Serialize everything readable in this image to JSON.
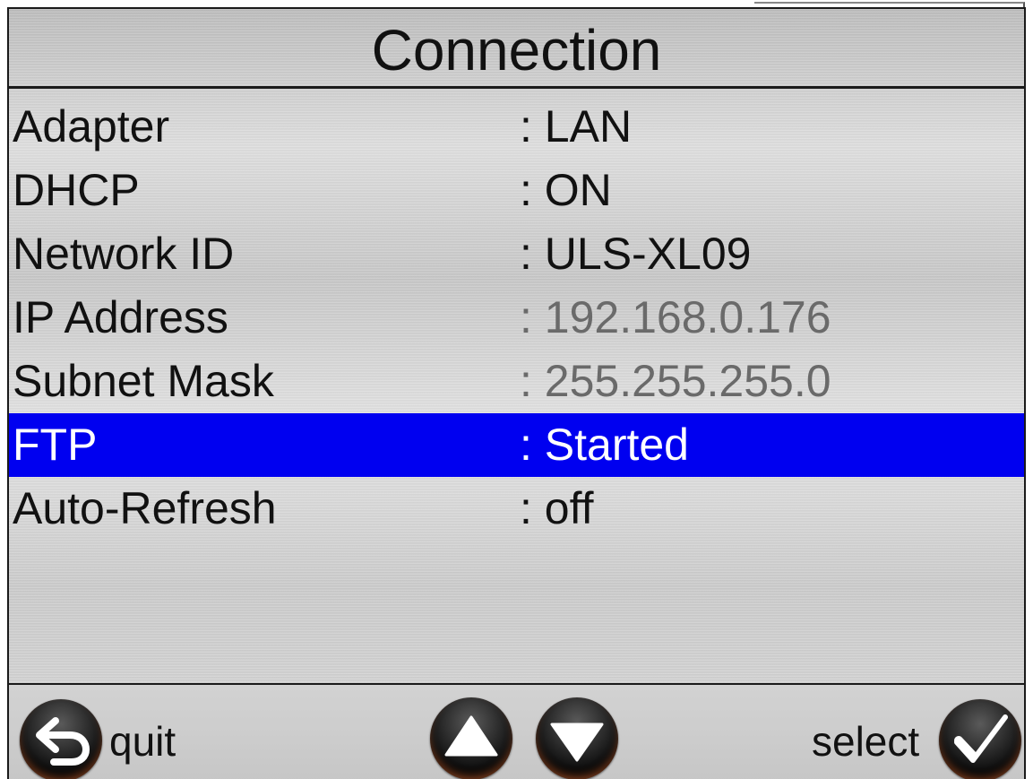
{
  "title": "Connection",
  "settings": [
    {
      "label": "Adapter",
      "value": ": LAN",
      "state": "normal"
    },
    {
      "label": "DHCP",
      "value": ": ON",
      "state": "normal"
    },
    {
      "label": "Network ID",
      "value": ": ULS-XL09",
      "state": "normal"
    },
    {
      "label": "IP Address",
      "value": ": 192.168.0.176",
      "state": "disabled"
    },
    {
      "label": "Subnet Mask",
      "value": ": 255.255.255.0",
      "state": "disabled"
    },
    {
      "label": "FTP",
      "value": ": Started",
      "state": "selected"
    },
    {
      "label": "Auto-Refresh",
      "value": ": off",
      "state": "normal"
    }
  ],
  "bottom_bar": {
    "quit_label": "quit",
    "select_label": "select",
    "quit_icon": "back-arrow-icon",
    "up_icon": "triangle-up-icon",
    "down_icon": "triangle-down-icon",
    "select_icon": "checkmark-icon"
  },
  "colors": {
    "selection": "#0000f0",
    "disabled_text": "#6a6a6a",
    "text": "#111111"
  }
}
